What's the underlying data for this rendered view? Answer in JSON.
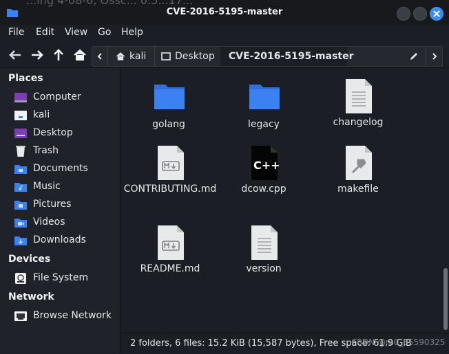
{
  "window": {
    "background_text": "...ing 4-08-6, Ossc... 0.5...17...",
    "title": "CVE-2016-5195-master"
  },
  "menubar": {
    "items": [
      "File",
      "Edit",
      "View",
      "Go",
      "Help"
    ]
  },
  "pathbar": {
    "segments": [
      "kali",
      "Desktop",
      "CVE-2016-5195-master"
    ]
  },
  "sidebar": {
    "sections": [
      {
        "title": "Places",
        "items": [
          "Computer",
          "kali",
          "Desktop",
          "Trash",
          "Documents",
          "Music",
          "Pictures",
          "Videos",
          "Downloads"
        ]
      },
      {
        "title": "Devices",
        "items": [
          "File System"
        ]
      },
      {
        "title": "Network",
        "items": [
          "Browse Network"
        ]
      }
    ]
  },
  "files": [
    {
      "name": "golang",
      "icon": "folder-icon"
    },
    {
      "name": "legacy",
      "icon": "folder-icon"
    },
    {
      "name": "changelog",
      "icon": "text-file-icon"
    },
    {
      "name": "CONTRIBUTING.md",
      "icon": "markdown-file-icon"
    },
    {
      "name": "dcow.cpp",
      "icon": "cpp-file-icon"
    },
    {
      "name": "makefile",
      "icon": "makefile-icon"
    },
    {
      "name": "README.md",
      "icon": "markdown-file-icon"
    },
    {
      "name": "version",
      "icon": "text-file-icon"
    }
  ],
  "status": {
    "text": "2 folders, 6 files: 15.2 KiB (15,587 bytes), Free space: 61.9 GiB"
  },
  "watermark": "CSDN @m0_65590325",
  "colors": {
    "accent": "#3b8ef0",
    "folder": "#3b82f0",
    "background": "#1b1e24"
  }
}
